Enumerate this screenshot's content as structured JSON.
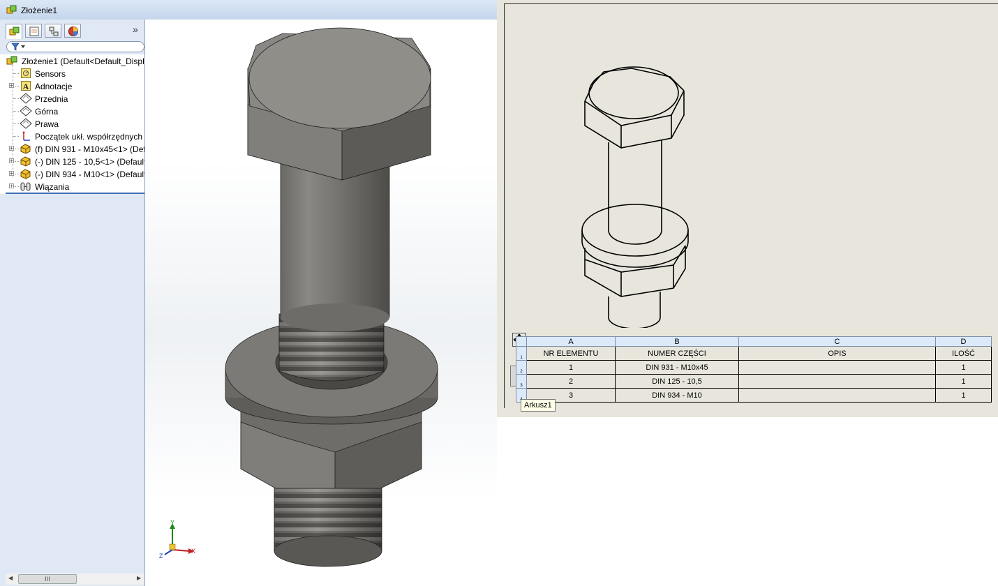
{
  "window": {
    "title": "Złożenie1"
  },
  "feature_tree": {
    "root": "Złożenie1  (Default<Default_Displ",
    "items": [
      {
        "label": "Sensors",
        "icon": "sensors-icon",
        "expandable": false
      },
      {
        "label": "Adnotacje",
        "icon": "annotations-icon",
        "expandable": true
      },
      {
        "label": "Przednia",
        "icon": "plane-icon",
        "expandable": false
      },
      {
        "label": "Górna",
        "icon": "plane-icon",
        "expandable": false
      },
      {
        "label": "Prawa",
        "icon": "plane-icon",
        "expandable": false
      },
      {
        "label": "Początek ukł. współrzędnych",
        "icon": "origin-icon",
        "expandable": false
      },
      {
        "label": "(f) DIN 931 - M10x45<1> (Def",
        "icon": "part-icon",
        "expandable": true
      },
      {
        "label": "(-) DIN 125 - 10,5<1> (Default",
        "icon": "part-icon",
        "expandable": true
      },
      {
        "label": "(-) DIN 934 - M10<1> (Default",
        "icon": "part-icon",
        "expandable": true
      },
      {
        "label": "Wiązania",
        "icon": "mates-icon",
        "expandable": true
      }
    ],
    "more_symbol": "»",
    "scroll_thumb": "III"
  },
  "triad": {
    "x": "X",
    "y": "Y",
    "z": "Z"
  },
  "bom": {
    "columns": [
      "A",
      "B",
      "C",
      "D"
    ],
    "row_numbers": [
      "1",
      "2",
      "3",
      "4"
    ],
    "headers": [
      "NR ELEMENTU",
      "NUMER CZĘŚCI",
      "OPIS",
      "ILOŚĆ"
    ],
    "rows": [
      [
        "1",
        "DIN 931 - M10x45",
        "",
        "1"
      ],
      [
        "2",
        "DIN 125 - 10,5",
        "",
        "1"
      ],
      [
        "3",
        "DIN 934 - M10",
        "",
        "1"
      ]
    ]
  },
  "sheet_tab": "Arkusz1",
  "colors": {
    "accent": "#3d6fb5",
    "sheet": "#e8e6dc",
    "panel": "#dfe8f4",
    "metal": "#7c7a76"
  }
}
